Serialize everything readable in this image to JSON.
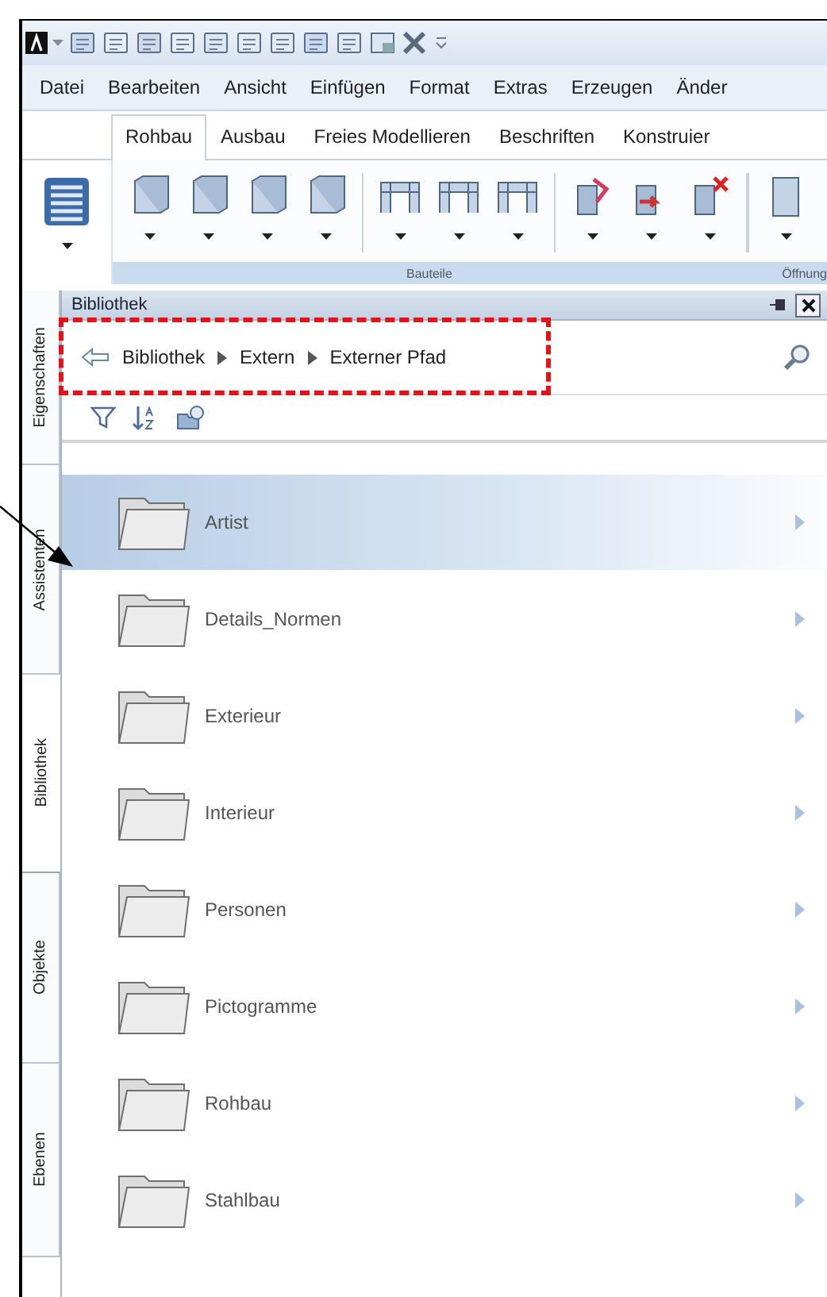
{
  "menu": [
    "Datei",
    "Bearbeiten",
    "Ansicht",
    "Einfügen",
    "Format",
    "Extras",
    "Erzeugen",
    "Änder"
  ],
  "ribbon_tabs": [
    {
      "label": "Rohbau",
      "selected": true
    },
    {
      "label": "Ausbau",
      "selected": false
    },
    {
      "label": "Freies Modellieren",
      "selected": false
    },
    {
      "label": "Beschriften",
      "selected": false
    },
    {
      "label": "Konstruier",
      "selected": false
    }
  ],
  "ribbon_groups": [
    {
      "label": "Bauteile"
    },
    {
      "label": "Öffnung"
    }
  ],
  "side_tabs": [
    {
      "label": "Eigenschaften",
      "selected": false
    },
    {
      "label": "Assistenten",
      "selected": false
    },
    {
      "label": "Bibliothek",
      "selected": true
    },
    {
      "label": "Objekte",
      "selected": false
    },
    {
      "label": "Ebenen",
      "selected": false
    }
  ],
  "panel": {
    "title": "Bibliothek",
    "breadcrumb": [
      "Bibliothek",
      "Extern",
      "Externer Pfad"
    ]
  },
  "folders": [
    {
      "name": "Artist",
      "selected": true
    },
    {
      "name": "Details_Normen",
      "selected": false
    },
    {
      "name": "Exterieur",
      "selected": false
    },
    {
      "name": "Interieur",
      "selected": false
    },
    {
      "name": "Personen",
      "selected": false
    },
    {
      "name": "Pictogramme",
      "selected": false
    },
    {
      "name": "Rohbau",
      "selected": false
    },
    {
      "name": "Stahlbau",
      "selected": false
    }
  ]
}
